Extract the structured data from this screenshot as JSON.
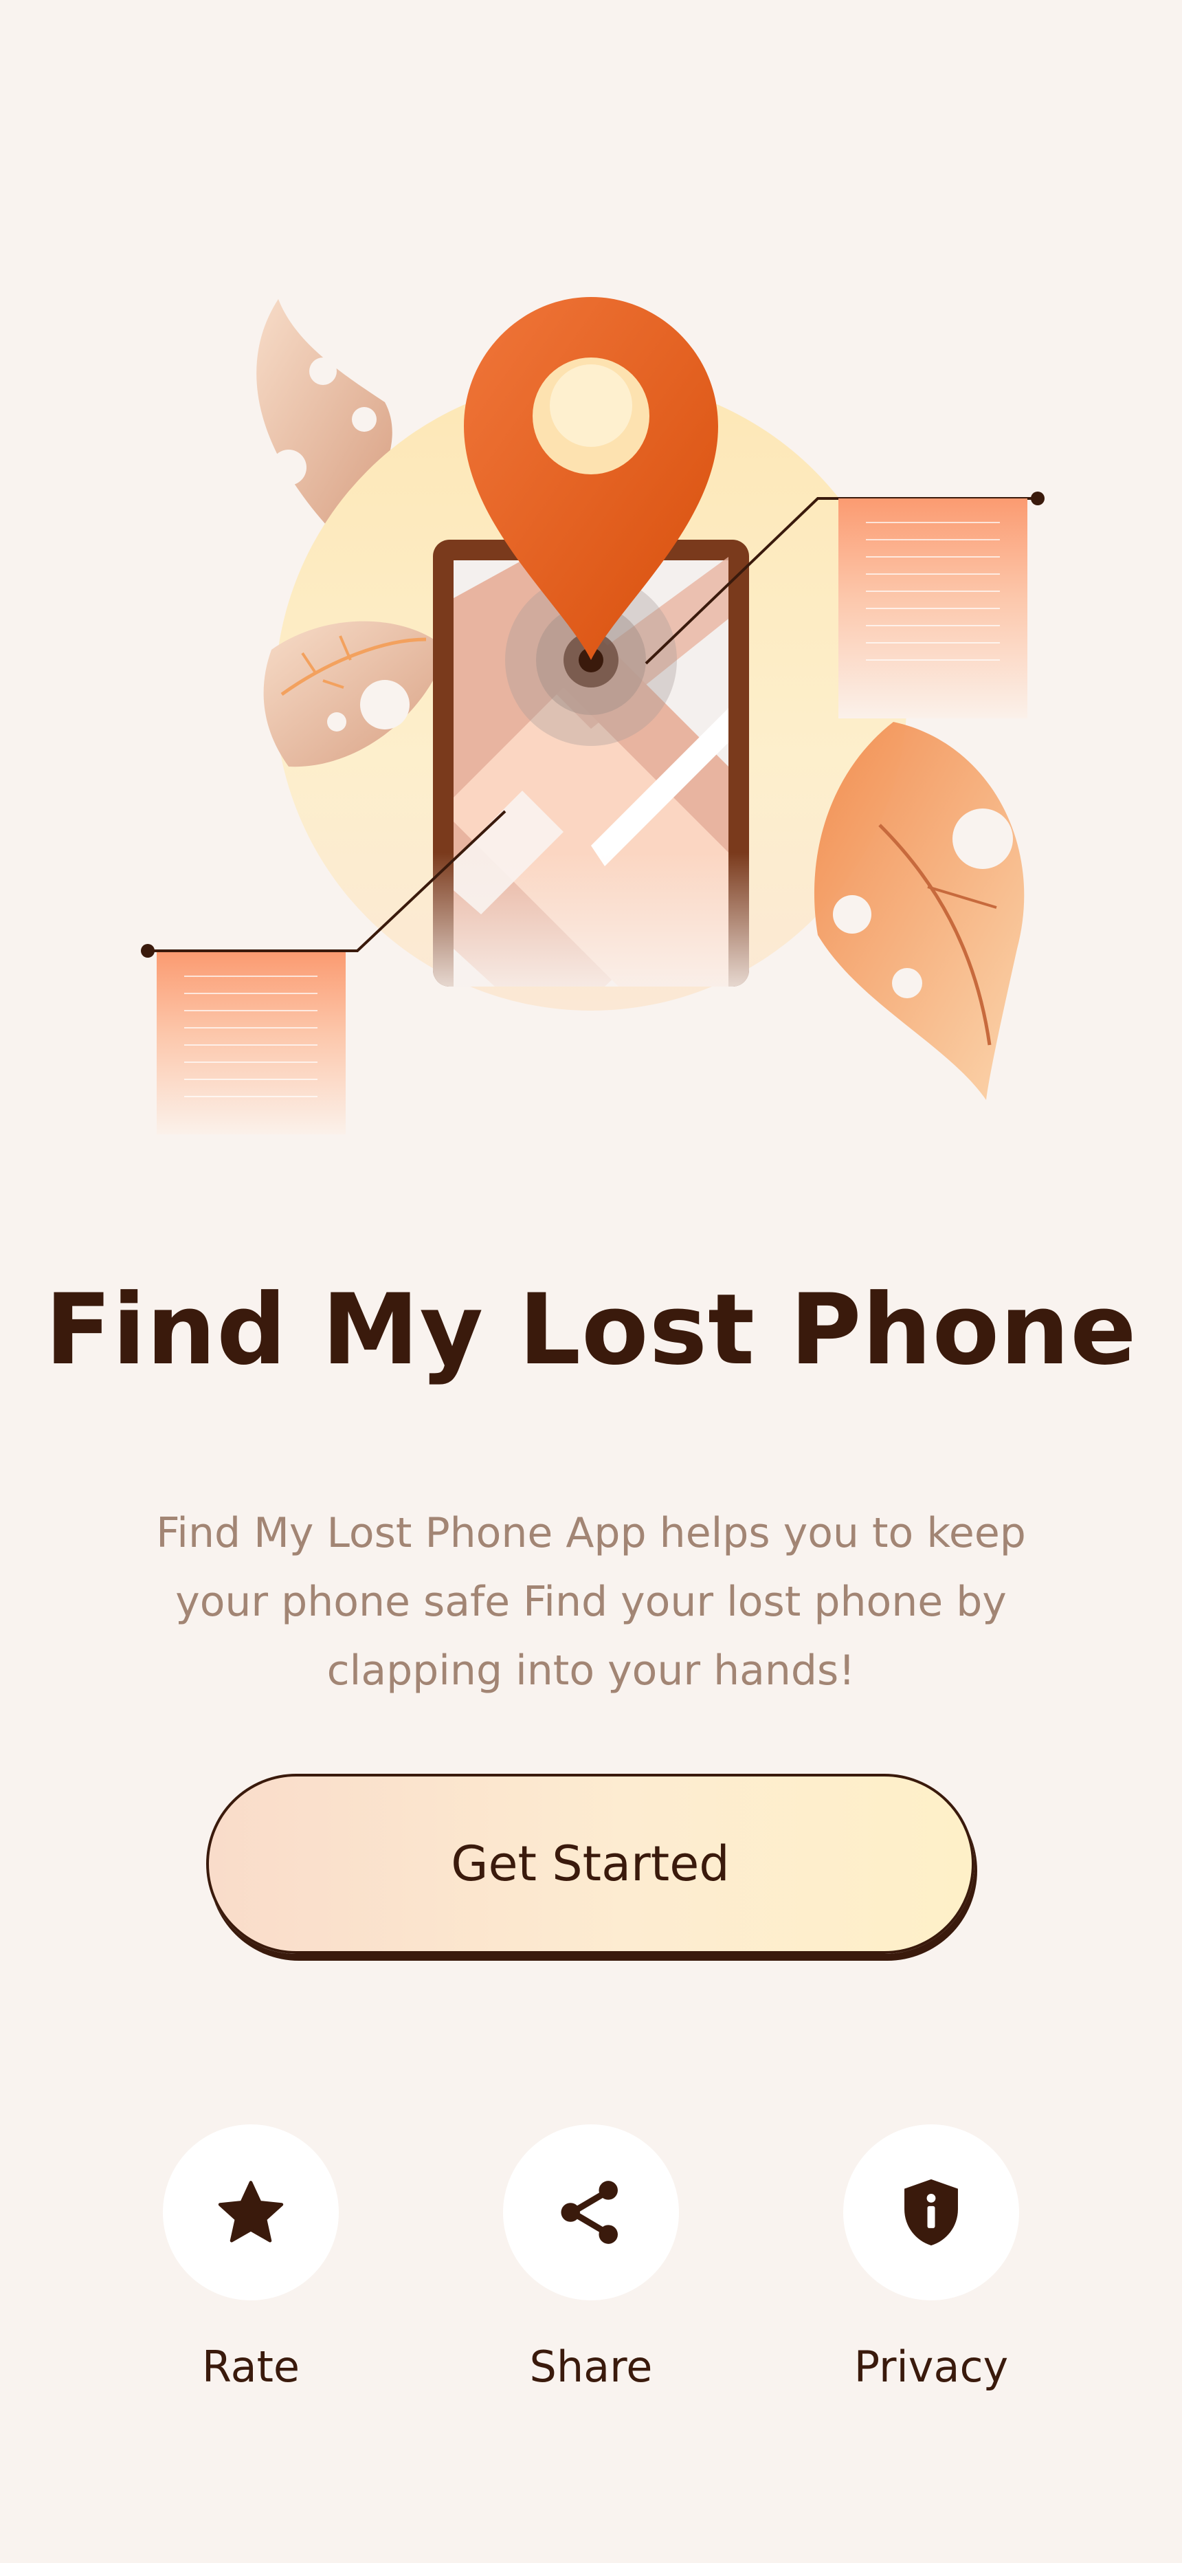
{
  "hero": {
    "illustration": "location-pin-on-phone-map"
  },
  "title": "Find My Lost Phone",
  "subtitle": "Find My Lost Phone App helps you to keep your phone safe Find your lost phone by clapping into your hands!",
  "cta": {
    "label": "Get Started"
  },
  "actions": [
    {
      "label": "Rate",
      "icon": "star-icon"
    },
    {
      "label": "Share",
      "icon": "share-icon"
    },
    {
      "label": "Privacy",
      "icon": "shield-info-icon"
    }
  ],
  "colors": {
    "background": "#f9f3ef",
    "title": "#3a1a0c",
    "subtitle": "#a28574",
    "accent": "#e05a16"
  }
}
